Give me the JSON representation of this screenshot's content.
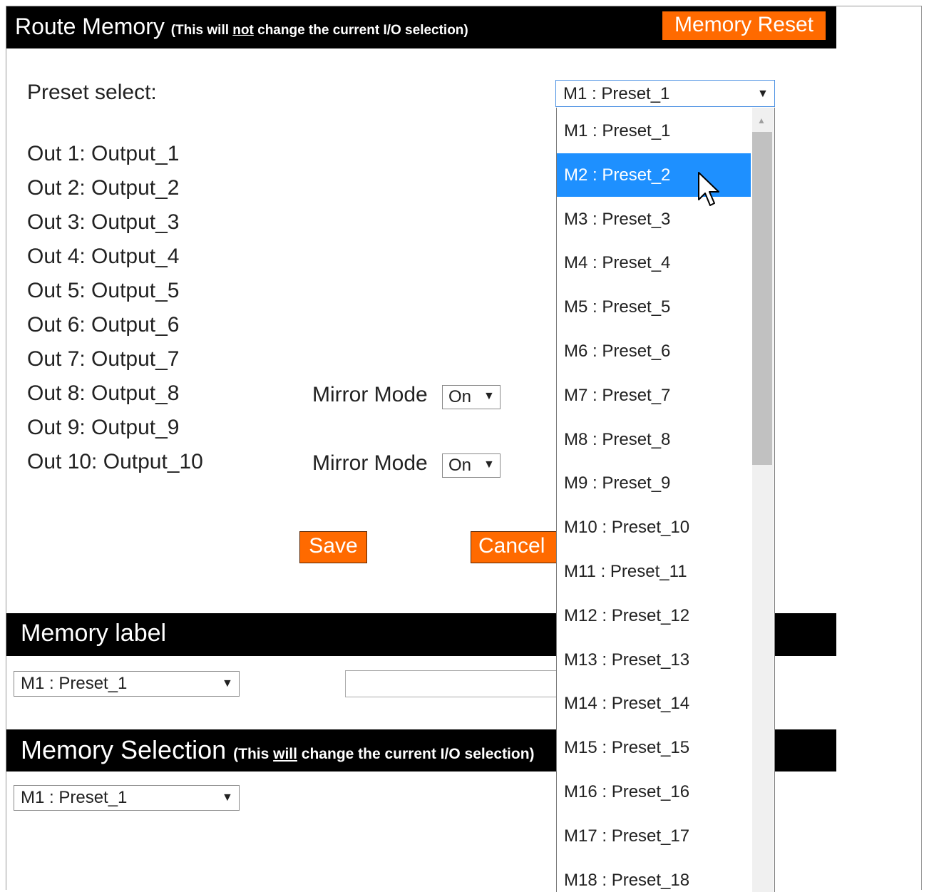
{
  "route_memory": {
    "title": "Route Memory",
    "note_prefix": "(This will ",
    "note_emphasis": "not",
    "note_suffix": " change the current I/O selection)",
    "reset_button": "Memory Reset",
    "preset_label": "Preset select:",
    "preset_selected": "M1 : Preset_1",
    "outputs": [
      "Out 1: Output_1",
      "Out 2: Output_2",
      "Out 3: Output_3",
      "Out 4: Output_4",
      "Out 5: Output_5",
      "Out 6: Output_6",
      "Out 7: Output_7",
      "Out 8: Output_8",
      "Out 9: Output_9",
      "Out 10: Output_10"
    ],
    "mirror_mode_label": "Mirror Mode",
    "mirror_value_out8": "On",
    "mirror_value_out10": "On",
    "save_button": "Save",
    "cancel_button": "Cancel"
  },
  "preset_dropdown": {
    "highlighted": "M2 : Preset_2",
    "options": [
      "M1 : Preset_1",
      "M2 : Preset_2",
      "M3 : Preset_3",
      "M4 : Preset_4",
      "M5 : Preset_5",
      "M6 : Preset_6",
      "M7 : Preset_7",
      "M8 : Preset_8",
      "M9 : Preset_9",
      "M10 : Preset_10",
      "M11 : Preset_11",
      "M12 : Preset_12",
      "M13 : Preset_13",
      "M14 : Preset_14",
      "M15 : Preset_15",
      "M16 : Preset_16",
      "M17 : Preset_17",
      "M18 : Preset_18"
    ]
  },
  "memory_label": {
    "title": "Memory label",
    "selected": "M1 : Preset_1",
    "input_value": ""
  },
  "memory_selection": {
    "title": "Memory Selection",
    "note_prefix": "(This ",
    "note_emphasis": "will",
    "note_suffix": " change the current I/O selection)",
    "selected": "M1 : Preset_1"
  },
  "icons": {
    "select_arrow": "▼",
    "scroll_up": "▲",
    "cursor": "mouse-pointer-icon"
  },
  "colors": {
    "header_bg": "#000000",
    "button_orange": "#ff6a00",
    "highlight": "#1e90ff",
    "scroll_thumb": "#c1c1c1"
  }
}
